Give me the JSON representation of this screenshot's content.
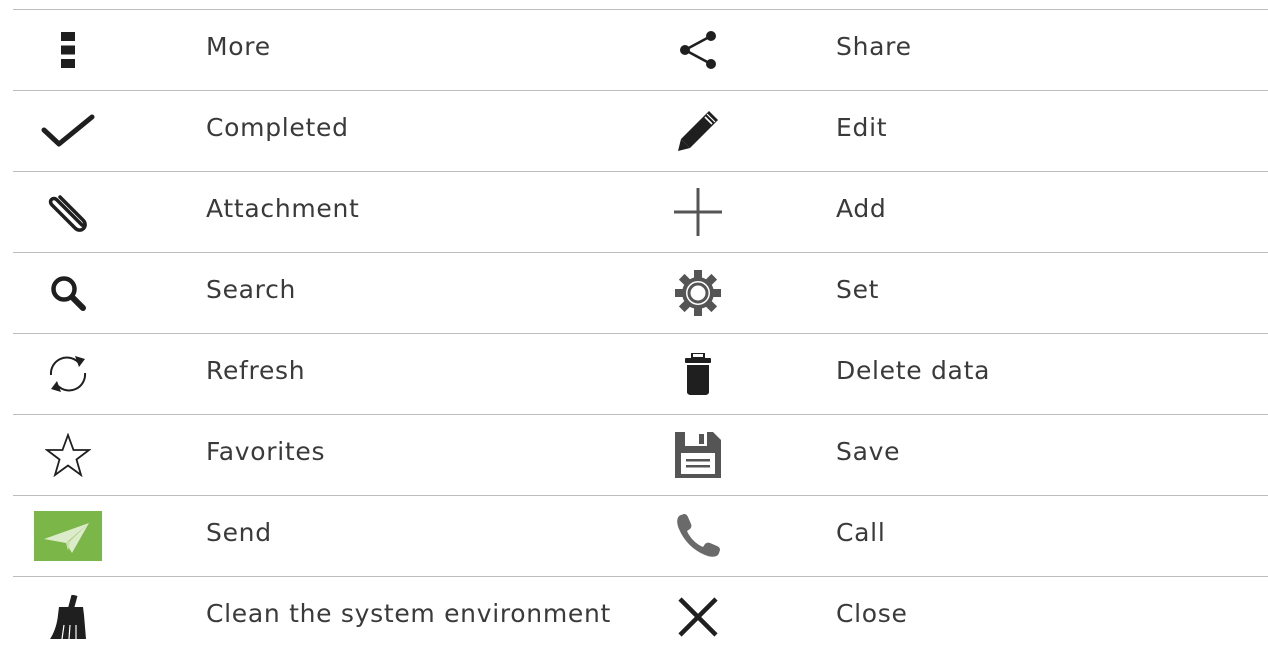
{
  "rows": [
    {
      "left": {
        "icon": "more-icon",
        "label": "More"
      },
      "right": {
        "icon": "share-icon",
        "label": "Share"
      }
    },
    {
      "left": {
        "icon": "checkmark-icon",
        "label": "Completed"
      },
      "right": {
        "icon": "pencil-icon",
        "label": "Edit"
      }
    },
    {
      "left": {
        "icon": "paperclip-icon",
        "label": "Attachment"
      },
      "right": {
        "icon": "plus-icon",
        "label": "Add"
      }
    },
    {
      "left": {
        "icon": "search-icon",
        "label": "Search"
      },
      "right": {
        "icon": "gear-icon",
        "label": "Set"
      }
    },
    {
      "left": {
        "icon": "refresh-icon",
        "label": "Refresh"
      },
      "right": {
        "icon": "trash-icon",
        "label": "Delete data"
      }
    },
    {
      "left": {
        "icon": "star-icon",
        "label": "Favorites"
      },
      "right": {
        "icon": "save-icon",
        "label": "Save"
      }
    },
    {
      "left": {
        "icon": "send-icon",
        "label": "Send"
      },
      "right": {
        "icon": "phone-icon",
        "label": "Call"
      }
    },
    {
      "left": {
        "icon": "broom-icon",
        "label": "Clean the system environment"
      },
      "right": {
        "icon": "close-icon",
        "label": "Close"
      }
    }
  ],
  "colors": {
    "icon_dark": "#1f1f1f",
    "icon_gray": "#555555",
    "send_background": "#7ab648",
    "divider": "#bdbdbd",
    "text": "#3a3a3a"
  }
}
